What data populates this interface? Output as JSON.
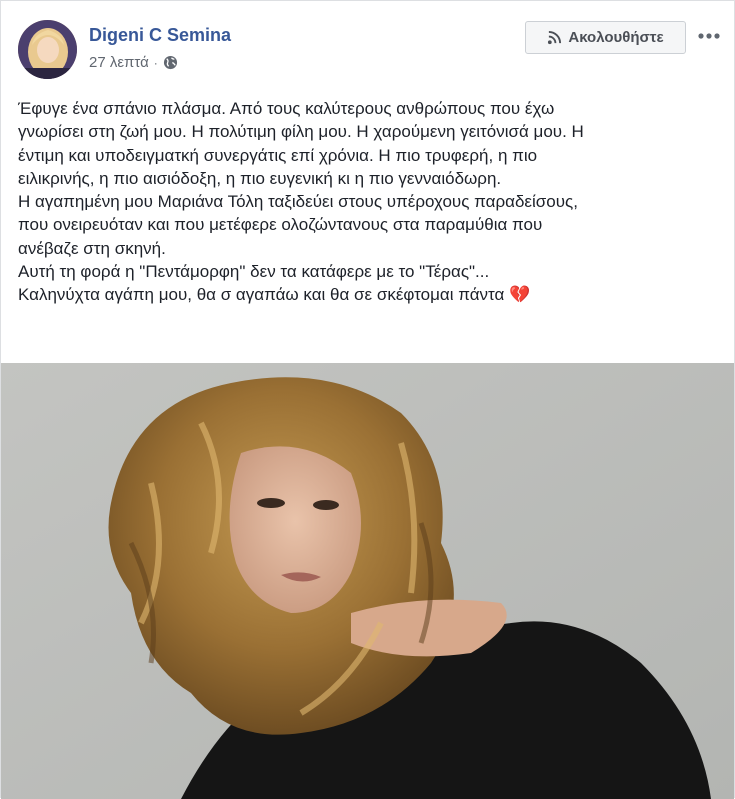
{
  "post": {
    "author": "Digeni C Semina",
    "time": "27 λεπτά",
    "separator": "·",
    "follow_label": "Ακολουθήστε",
    "lines": [
      "Έφυγε ένα σπάνιο πλάσμα. Από τους καλύτερους ανθρώπους που έχω",
      "γνωρίσει στη ζωή μου. Η πολύτιμη φίλη μου. Η χαρούμενη γειτόνισά μου. Η",
      "έντιμη και υποδειγματκή συνεργάτις επί χρόνια. Η πιο τρυφερή, η πιο",
      "ειλικρινής, η πιο αισιόδοξη, η πιο ευγενική κι η πιο γενναιόδωρη.",
      "Η αγαπημένη μου Μαριάνα Τόλη ταξιδεύει στους υπέροχους παραδείσους,",
      "που ονειρευόταν και που μετέφερε ολοζώντανους στα παραμύθια που",
      "ανέβαζε στη σκηνή.",
      "Αυτή τη φορά η \"Πεντάμορφη\" δεν τα κατάφερε με το \"Τέρας\"...",
      "Καληνύχτα αγάπη μου, θα σ αγαπάω και θα σε σκέφτομαι πάντα 💔"
    ],
    "icons": {
      "privacy": "globe-icon",
      "follow": "rss-icon",
      "more": "more-horizontal-icon"
    },
    "colors": {
      "author": "#385898",
      "meta": "#616770",
      "button_bg": "#f5f6f7"
    }
  }
}
